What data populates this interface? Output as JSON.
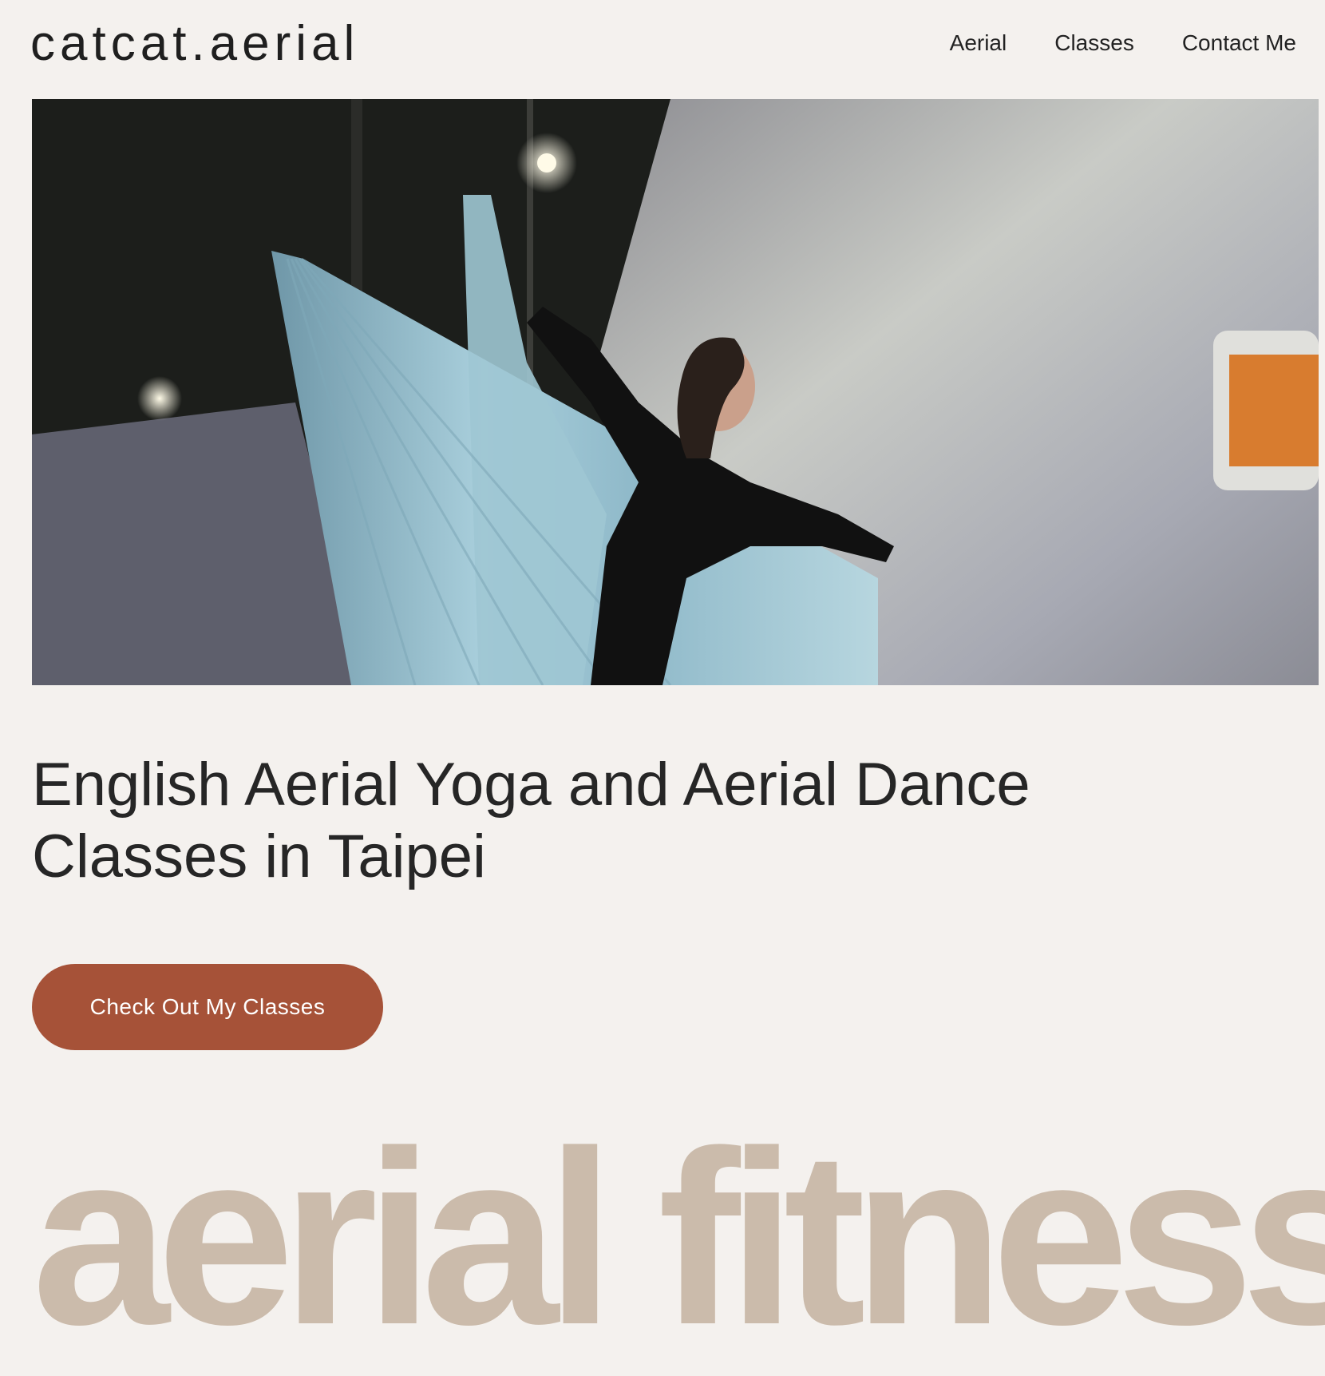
{
  "brand": {
    "logo_text": "catcat.aerial"
  },
  "nav": {
    "items": [
      {
        "label": "Aerial"
      },
      {
        "label": "Classes"
      },
      {
        "label": "Contact Me"
      }
    ]
  },
  "hero": {
    "image_subject": "aerial-silks-performer-photo"
  },
  "main": {
    "headline": "English Aerial Yoga and Aerial Dance Classes in Taipei",
    "cta_label": "Check Out My Classes",
    "display_text": "aerial fitness"
  },
  "colors": {
    "background": "#f4f1ee",
    "cta": "#a65238",
    "display_text": "#cbbbab",
    "text": "#262626"
  }
}
